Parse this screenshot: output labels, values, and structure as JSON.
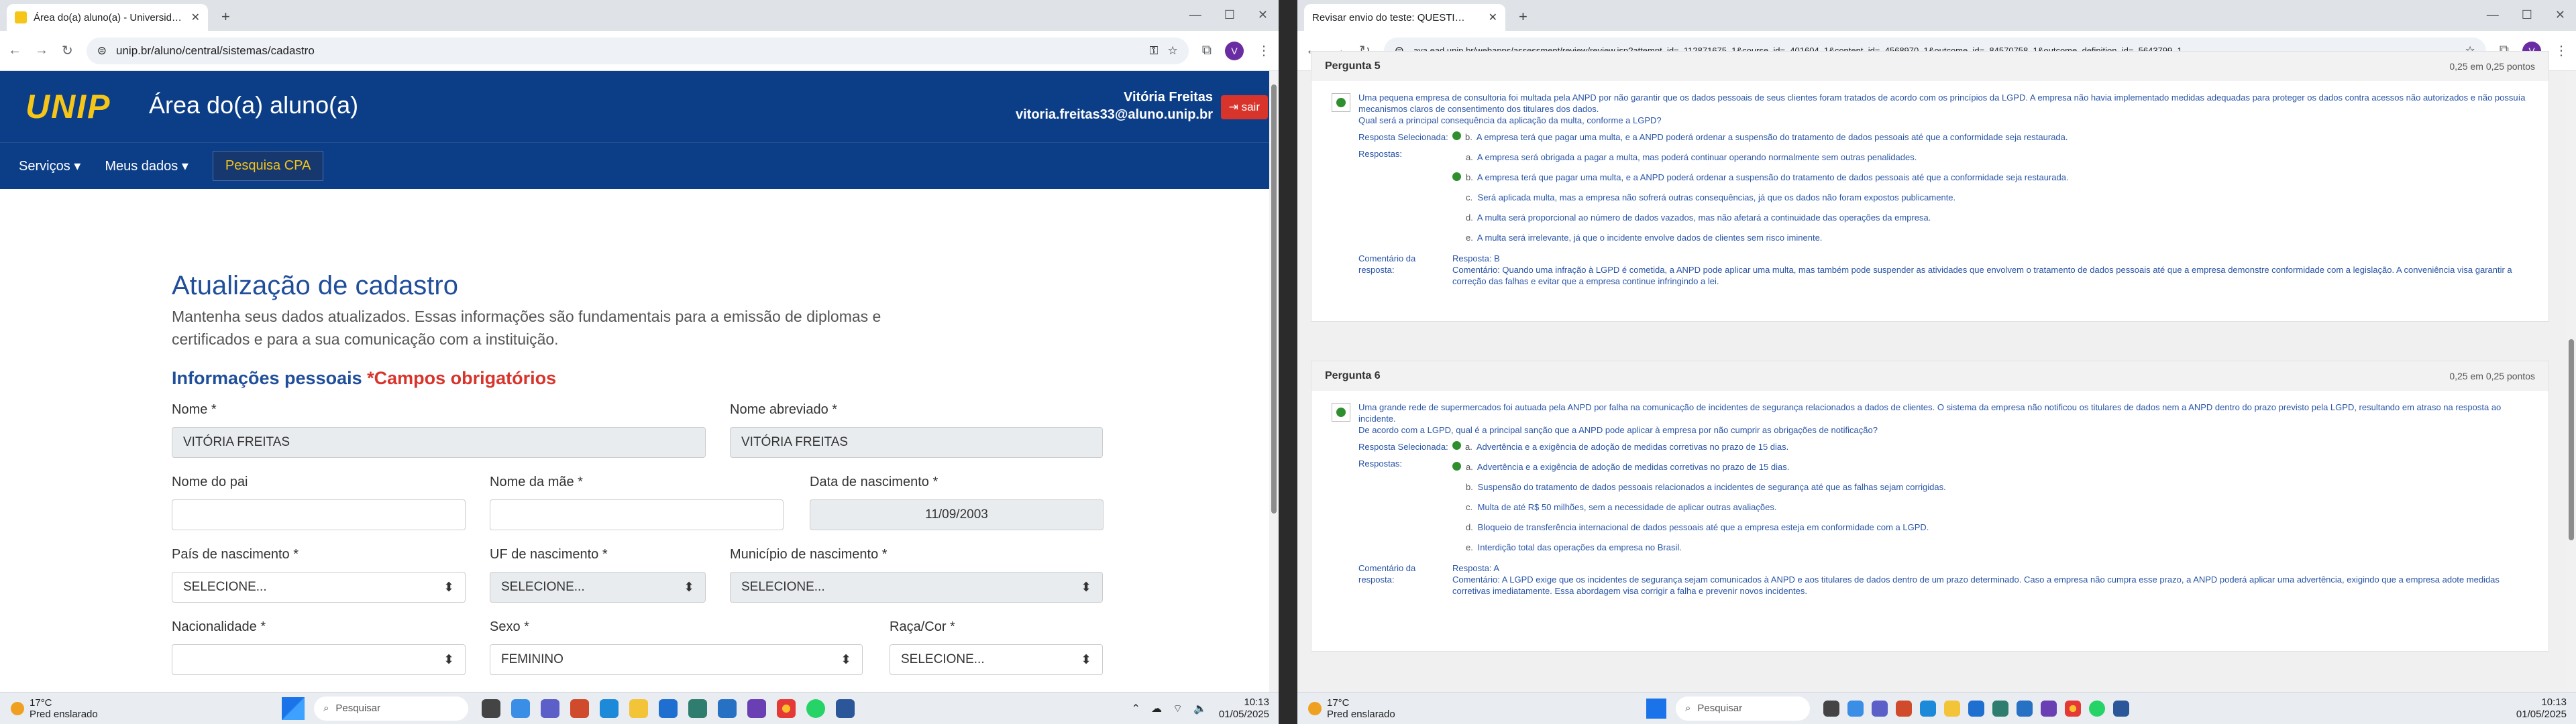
{
  "left": {
    "tab_title": "Área do(a) aluno(a) - Universid…",
    "url": "unip.br/aluno/central/sistemas/cadastro",
    "avatar": "V",
    "header": {
      "logo": "UNIP",
      "area": "Área do(a) aluno(a)",
      "user_name": "Vitória Freitas",
      "user_email": "vitoria.freitas33@aluno.unip.br",
      "logout": "sair"
    },
    "nav": {
      "services": "Serviços",
      "my_data": "Meus dados",
      "cpa": "Pesquisa CPA"
    },
    "form": {
      "title": "Atualização de cadastro",
      "intro": "Mantenha seus dados atualizados. Essas informações são fundamentais para a emissão de diplomas e certificados e para a sua comunicação com a instituição.",
      "section": "Informações pessoais ",
      "required": "*Campos obrigatórios",
      "nome_l": "Nome *",
      "nome_v": "VITÓRIA FREITAS",
      "abrev_l": "Nome abreviado *",
      "abrev_v": "VITÓRIA FREITAS",
      "pai_l": "Nome do pai",
      "mae_l": "Nome da mãe *",
      "nasc_l": "Data de nascimento *",
      "nasc_v": "11/09/2003",
      "pais_l": "País de nascimento *",
      "pais_v": "SELECIONE...",
      "uf_l": "UF de nascimento *",
      "uf_v": "SELECIONE...",
      "mun_l": "Município de nascimento *",
      "mun_v": "SELECIONE...",
      "nac_l": "Nacionalidade *",
      "sexo_l": "Sexo *",
      "sexo_v": "FEMININO",
      "raca_l": "Raça/Cor *",
      "raca_v": "SELECIONE..."
    },
    "taskbar": {
      "temp": "17°C",
      "weather": "Pred enslarado",
      "search": "Pesquisar",
      "time": "10:13",
      "date": "01/05/2025"
    }
  },
  "right": {
    "tab_title": "Revisar envio do teste: QUESTI…",
    "url": "ava.ead.unip.br/webapps/assessment/review/review.jsp?attempt_id=_112871675_1&course_id=_401604_1&content_id=_4568970_1&outcome_id=_84570758_1&outcome_definition_id=_5643799_1",
    "avatar": "V",
    "q5": {
      "title": "Pergunta 5",
      "points": "0,25 em 0,25 pontos",
      "text": "Uma pequena empresa de consultoria foi multada pela ANPD por não garantir que os dados pessoais de seus clientes foram tratados de acordo com os princípios da LGPD. A empresa não havia implementado medidas adequadas para proteger os dados contra acessos não autorizados e não possuía mecanismos claros de consentimento dos titulares dos dados.",
      "question": "Qual será a principal consequência da aplicação da multa, conforme a LGPD?",
      "sel_label": "Resposta Selecionada:",
      "sel_letter": "b.",
      "sel": "A empresa terá que pagar uma multa, e a ANPD poderá ordenar a suspensão do tratamento de dados pessoais até que a conformidade seja restaurada.",
      "resp_label": "Respostas:",
      "options": [
        {
          "l": "a.",
          "t": "A empresa será obrigada a pagar a multa, mas poderá continuar operando normalmente sem outras penalidades."
        },
        {
          "l": "b.",
          "t": "A empresa terá que pagar uma multa, e a ANPD poderá ordenar a suspensão do tratamento de dados pessoais até que a conformidade seja restaurada."
        },
        {
          "l": "c.",
          "t": "Será aplicada multa, mas a empresa não sofrerá outras consequências, já que os dados não foram expostos publicamente."
        },
        {
          "l": "d.",
          "t": "A multa será proporcional ao número de dados vazados, mas não afetará a continuidade das operações da empresa."
        },
        {
          "l": "e.",
          "t": "A multa será irrelevante, já que o incidente envolve dados de clientes sem risco iminente."
        }
      ],
      "comment_label": "Comentário da resposta:",
      "comment1": "Resposta: B",
      "comment2": "Comentário: Quando uma infração à LGPD é cometida, a ANPD pode aplicar uma multa, mas também pode suspender as atividades que envolvem o tratamento de dados pessoais até que a empresa demonstre conformidade com a legislação. A conveniência visa garantir a correção das falhas e evitar que a empresa continue infringindo a lei."
    },
    "q6": {
      "title": "Pergunta 6",
      "points": "0,25 em 0,25 pontos",
      "text": "Uma grande rede de supermercados foi autuada pela ANPD por falha na comunicação de incidentes de segurança relacionados a dados de clientes. O sistema da empresa não notificou os titulares de dados nem a ANPD dentro do prazo previsto pela LGPD, resultando em atraso na resposta ao incidente.",
      "question": "De acordo com a LGPD, qual é a principal sanção que a ANPD pode aplicar à empresa por não cumprir as obrigações de notificação?",
      "sel_label": "Resposta Selecionada:",
      "sel_letter": "a.",
      "sel": "Advertência e a exigência de adoção de medidas corretivas no prazo de 15 dias.",
      "resp_label": "Respostas:",
      "options": [
        {
          "l": "a.",
          "t": "Advertência e a exigência de adoção de medidas corretivas no prazo de 15 dias."
        },
        {
          "l": "b.",
          "t": "Suspensão do tratamento de dados pessoais relacionados a incidentes de segurança até que as falhas sejam corrigidas."
        },
        {
          "l": "c.",
          "t": "Multa de até R$ 50 milhões, sem a necessidade de aplicar outras avaliações."
        },
        {
          "l": "d.",
          "t": "Bloqueio de transferência internacional de dados pessoais até que a empresa esteja em conformidade com a LGPD."
        },
        {
          "l": "e.",
          "t": "Interdição total das operações da empresa no Brasil."
        }
      ],
      "comment_label": "Comentário da resposta:",
      "comment1": "Resposta: A",
      "comment2": "Comentário: A LGPD exige que os incidentes de segurança sejam comunicados à ANPD e aos titulares de dados dentro de um prazo determinado. Caso a empresa não cumpra esse prazo, a ANPD poderá aplicar uma advertência, exigindo que a empresa adote medidas corretivas imediatamente. Essa abordagem visa corrigir a falha e prevenir novos incidentes."
    },
    "taskbar": {
      "temp": "17°C",
      "weather": "Pred enslarado",
      "search": "Pesquisar",
      "time": "10:13",
      "date": "01/05/2025"
    }
  }
}
